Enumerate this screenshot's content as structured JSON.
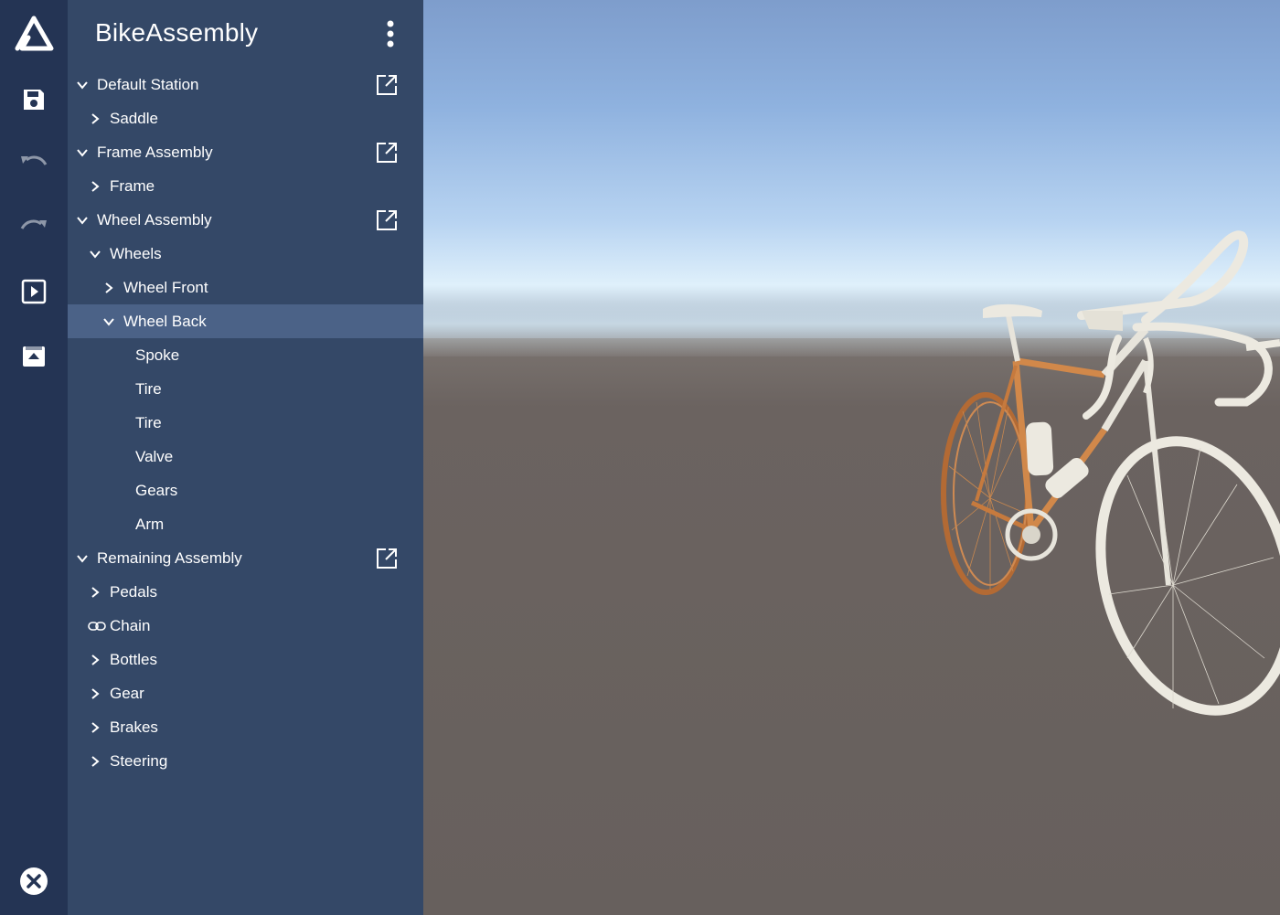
{
  "app": {
    "title": "BikeAssembly"
  },
  "rail": {
    "items": [
      {
        "icon": "save-icon"
      },
      {
        "icon": "undo-icon"
      },
      {
        "icon": "redo-icon"
      },
      {
        "icon": "play-icon"
      },
      {
        "icon": "upload-icon"
      }
    ],
    "close_icon": "close-icon"
  },
  "tree": [
    {
      "label": "Default Station",
      "state": "expanded",
      "level": 0,
      "external": true
    },
    {
      "label": "Saddle",
      "state": "collapsed",
      "level": 1
    },
    {
      "label": "Frame Assembly",
      "state": "expanded",
      "level": 0,
      "external": true
    },
    {
      "label": "Frame",
      "state": "collapsed",
      "level": 1
    },
    {
      "label": "Wheel Assembly",
      "state": "expanded",
      "level": 0,
      "external": true
    },
    {
      "label": "Wheels",
      "state": "expanded",
      "level": 1
    },
    {
      "label": "Wheel Front",
      "state": "collapsed",
      "level": 2
    },
    {
      "label": "Wheel Back",
      "state": "expanded",
      "level": 2,
      "selected": true
    },
    {
      "label": "Spoke",
      "state": "leaf",
      "level": 3
    },
    {
      "label": "Tire",
      "state": "leaf",
      "level": 3
    },
    {
      "label": "Tire",
      "state": "leaf",
      "level": 3
    },
    {
      "label": "Valve",
      "state": "leaf",
      "level": 3
    },
    {
      "label": "Gears",
      "state": "leaf",
      "level": 3
    },
    {
      "label": "Arm",
      "state": "leaf",
      "level": 3
    },
    {
      "label": "Remaining Assembly",
      "state": "expanded",
      "level": 0,
      "external": true
    },
    {
      "label": "Pedals",
      "state": "collapsed",
      "level": 1
    },
    {
      "label": "Chain",
      "state": "linked",
      "level": 1
    },
    {
      "label": "Bottles",
      "state": "collapsed",
      "level": 1
    },
    {
      "label": "Gear",
      "state": "collapsed",
      "level": 1
    },
    {
      "label": "Brakes",
      "state": "collapsed",
      "level": 1
    },
    {
      "label": "Steering",
      "state": "collapsed",
      "level": 1
    }
  ],
  "colors": {
    "rail_bg": "#243454",
    "panel_bg": "#344867",
    "selected_row": "#4b6287",
    "bike_frame": "#c57a3e",
    "bike_parts": "#e6e3d9"
  }
}
